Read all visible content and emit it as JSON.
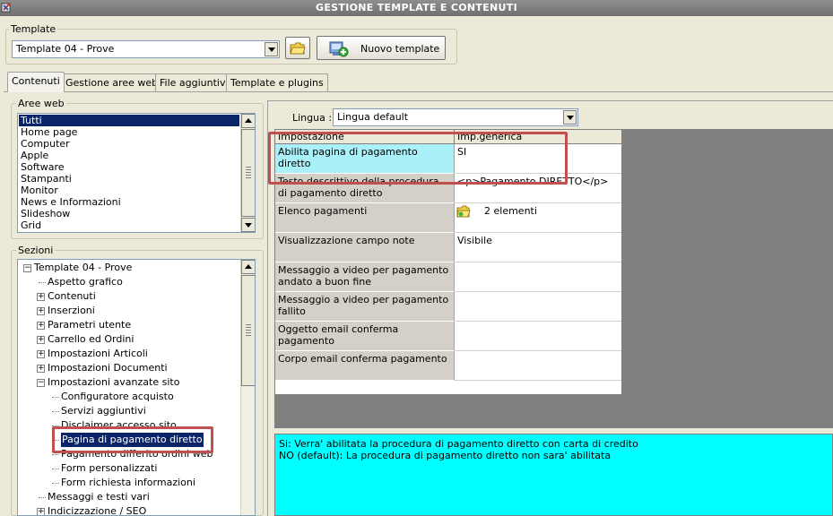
{
  "window": {
    "title": "GESTIONE TEMPLATE E CONTENUTI"
  },
  "template_group": {
    "label": "Template",
    "selected": "Template 04 - Prove",
    "new_button": "Nuovo template"
  },
  "tabs": [
    "Contenuti",
    "Gestione aree web",
    "File aggiuntivi",
    "Template e plugins"
  ],
  "aree_web": {
    "label": "Aree web",
    "items": [
      "Tutti",
      "Home page",
      "Computer",
      "Apple",
      "Software",
      "Stampanti",
      "Monitor",
      "News e Informazioni",
      "Slideshow",
      "Grid"
    ]
  },
  "sezioni": {
    "label": "Sezioni",
    "tree": [
      {
        "text": "Template 04 - Prove",
        "level": 0,
        "exp": "minus"
      },
      {
        "text": "Aspetto grafico",
        "level": 1,
        "exp": ""
      },
      {
        "text": "Contenuti",
        "level": 1,
        "exp": "plus"
      },
      {
        "text": "Inserzioni",
        "level": 1,
        "exp": "plus"
      },
      {
        "text": "Parametri utente",
        "level": 1,
        "exp": "plus"
      },
      {
        "text": "Carrello ed Ordini",
        "level": 1,
        "exp": "plus"
      },
      {
        "text": "Impostazioni Articoli",
        "level": 1,
        "exp": "plus"
      },
      {
        "text": "Impostazioni Documenti",
        "level": 1,
        "exp": "plus"
      },
      {
        "text": "Impostazioni avanzate sito",
        "level": 1,
        "exp": "minus"
      },
      {
        "text": "Configuratore acquisto",
        "level": 2,
        "exp": ""
      },
      {
        "text": "Servizi aggiuntivi",
        "level": 2,
        "exp": ""
      },
      {
        "text": "Disclaimer accesso sito",
        "level": 2,
        "exp": ""
      },
      {
        "text": "Pagina di pagamento diretto",
        "level": 2,
        "exp": "",
        "selected": true
      },
      {
        "text": "Pagamento differito ordini web",
        "level": 2,
        "exp": ""
      },
      {
        "text": "Form personalizzati",
        "level": 2,
        "exp": ""
      },
      {
        "text": "Form richiesta informazioni",
        "level": 2,
        "exp": ""
      },
      {
        "text": "Messaggi e testi vari",
        "level": 1,
        "exp": ""
      },
      {
        "text": "Indicizzazione / SEO",
        "level": 1,
        "exp": "plus"
      }
    ]
  },
  "lingua": {
    "label": "Lingua :",
    "selected": "Lingua default"
  },
  "grid": {
    "col_setting": "Impostazione",
    "col_value": "Imp.generica",
    "rows": [
      {
        "setting": "Abilita pagina di pagamento diretto",
        "value": "SI"
      },
      {
        "setting": "Testo descrittivo della procedura di pagamento diretto",
        "value": "<p>Pagamento DIRETTO</p>"
      },
      {
        "setting": "Elenco pagamenti",
        "value": "2 elementi"
      },
      {
        "setting": "Visualizzazione campo note",
        "value": "Visibile"
      },
      {
        "setting": "Messaggio a video per pagamento andato a buon fine",
        "value": ""
      },
      {
        "setting": "Messaggio a video per pagamento fallito",
        "value": ""
      },
      {
        "setting": "Oggetto email conferma pagamento",
        "value": ""
      },
      {
        "setting": "Corpo email conferma pagamento",
        "value": ""
      }
    ]
  },
  "description": {
    "line1": "Si: Verra' abilitata la procedura di pagamento diretto con carta di credito",
    "line2": "NO (default): La procedura di pagamento diretto non sara' abilitata"
  },
  "colors": {
    "selection": "#0a246a",
    "description_bg": "#00ffff",
    "highlight": "#c0504d",
    "grid_selected": "#aaf0f8"
  }
}
